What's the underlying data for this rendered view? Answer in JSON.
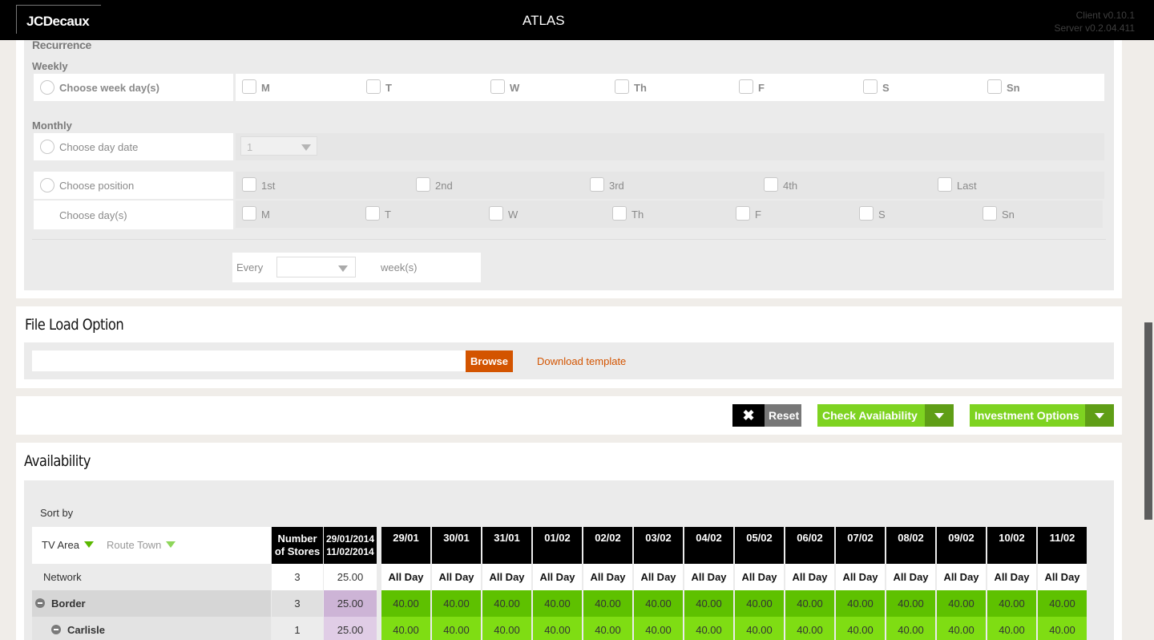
{
  "header": {
    "logo": "JCDecaux",
    "title": "ATLAS",
    "client_version": "Client v0.10.1",
    "server_version": "Server v0.2.04.411"
  },
  "recurrence": {
    "section_label": "Recurrence",
    "weekly_label": "Weekly",
    "choose_week_days": "Choose week day(s)",
    "week_days": [
      "M",
      "T",
      "W",
      "Th",
      "F",
      "S",
      "Sn"
    ],
    "monthly_label": "Monthly",
    "choose_day_date": "Choose day date",
    "day_date_value": "1",
    "choose_position": "Choose position",
    "positions": [
      "1st",
      "2nd",
      "3rd",
      "4th",
      "Last"
    ],
    "choose_days": "Choose day(s)",
    "days": [
      "M",
      "T",
      "W",
      "Th",
      "F",
      "S",
      "Sn"
    ],
    "every_label": "Every",
    "every_value": "",
    "weeks_label": "week(s)"
  },
  "file_load": {
    "title": "File Load Option",
    "file_value": "",
    "browse_label": "Browse",
    "download_label": "Download template"
  },
  "actions": {
    "reset_icon": "close-icon",
    "reset_label": "Reset",
    "check_label": "Check Availability",
    "investment_label": "Investment Options"
  },
  "availability": {
    "title": "Availability",
    "sort_by": "Sort by",
    "sort_tv_area": "TV Area",
    "sort_route_town": "Route Town",
    "col_stores_line1": "Number",
    "col_stores_line2": "of Stores",
    "col_period_line1": "29/01/2014",
    "col_period_line2": "11/02/2014",
    "dates": [
      "29/01",
      "30/01",
      "31/01",
      "01/02",
      "02/02",
      "03/02",
      "04/02",
      "05/02",
      "06/02",
      "07/02",
      "08/02",
      "09/02",
      "10/02",
      "11/02"
    ],
    "rows": [
      {
        "name": "Network",
        "stores": "3",
        "price": "25.00",
        "values": [
          "All Day",
          "All Day",
          "All Day",
          "All Day",
          "All Day",
          "All Day",
          "All Day",
          "All Day",
          "All Day",
          "All Day",
          "All Day",
          "All Day",
          "All Day",
          "All Day"
        ]
      },
      {
        "name": "Border",
        "stores": "3",
        "price": "25.00",
        "values": [
          "40.00",
          "40.00",
          "40.00",
          "40.00",
          "40.00",
          "40.00",
          "40.00",
          "40.00",
          "40.00",
          "40.00",
          "40.00",
          "40.00",
          "40.00",
          "40.00"
        ]
      },
      {
        "name": "Carlisle",
        "stores": "1",
        "price": "25.00",
        "values": [
          "40.00",
          "40.00",
          "40.00",
          "40.00",
          "40.00",
          "40.00",
          "40.00",
          "40.00",
          "40.00",
          "40.00",
          "40.00",
          "40.00",
          "40.00",
          "40.00"
        ]
      }
    ]
  },
  "colors": {
    "accent_orange": "#d35400",
    "green": "#7ed321",
    "green_dark": "#5f9e16"
  }
}
